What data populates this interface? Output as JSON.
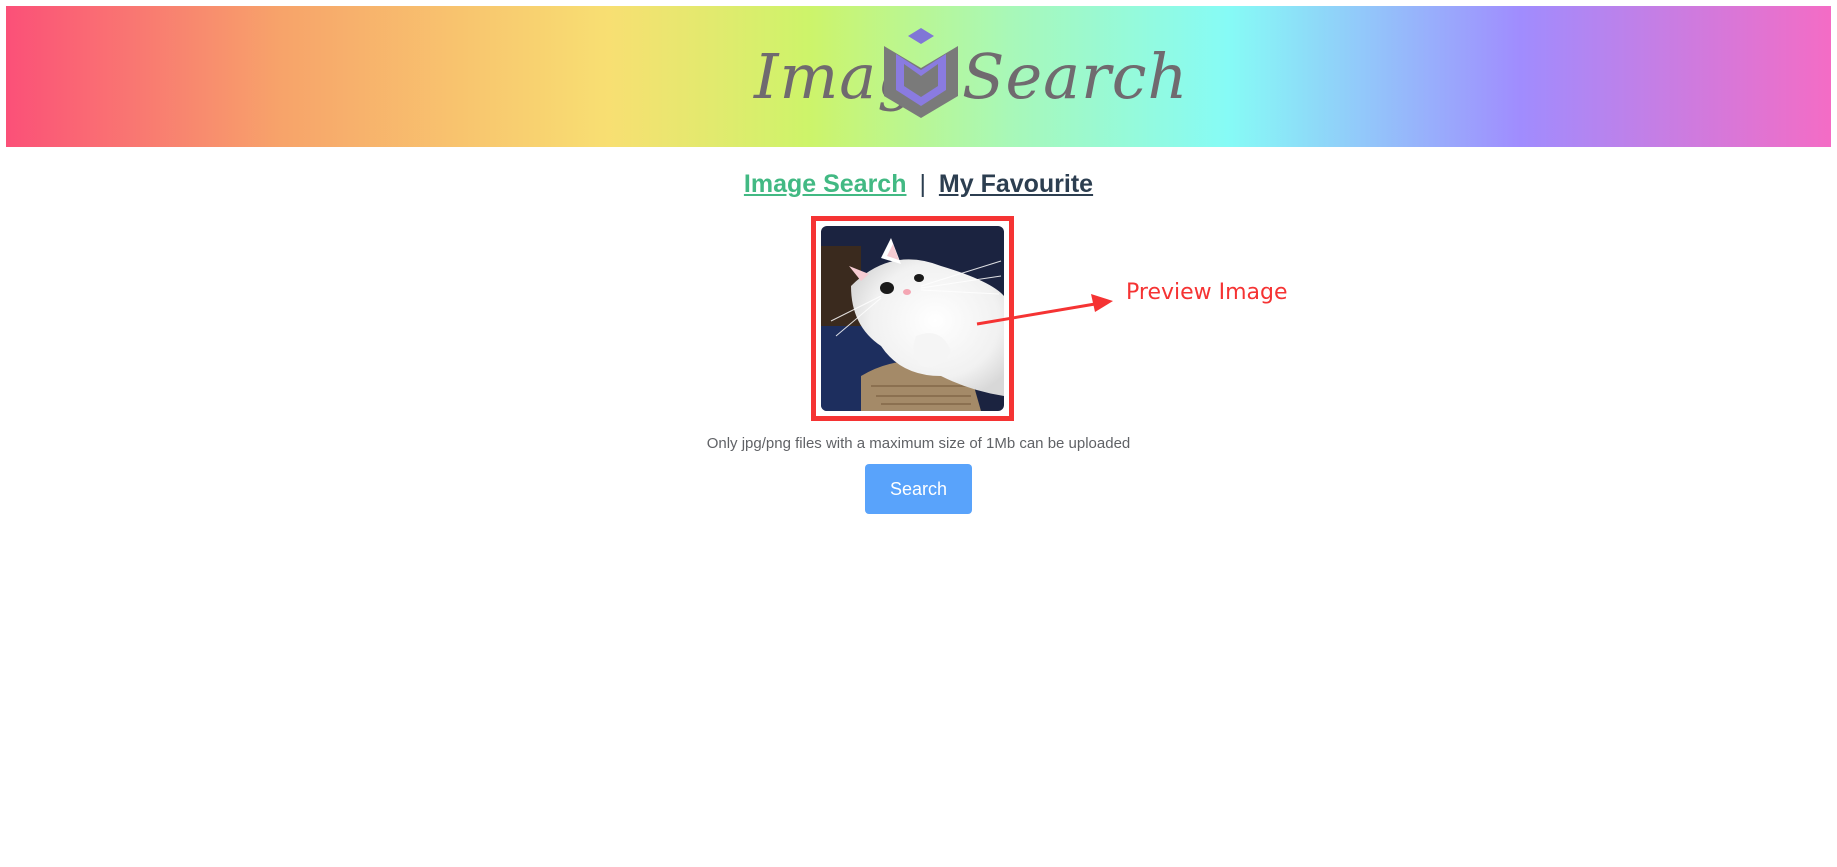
{
  "header": {
    "logo_left_text": "Image",
    "logo_right_text": "Search",
    "logo_icon": "cube-icon"
  },
  "nav": {
    "items": [
      {
        "label": "Image Search",
        "active": true
      },
      {
        "label": "My Favourite",
        "active": false
      }
    ],
    "separator": "|"
  },
  "preview": {
    "annotation_label": "Preview Image",
    "image_icon": "kitten-photo"
  },
  "upload": {
    "hint": "Only jpg/png files with a maximum size of 1Mb can be uploaded"
  },
  "actions": {
    "search_label": "Search"
  },
  "colors": {
    "active_link": "#42b983",
    "link": "#2c3e50",
    "annotation": "#f53333",
    "button": "#59a3fb"
  }
}
